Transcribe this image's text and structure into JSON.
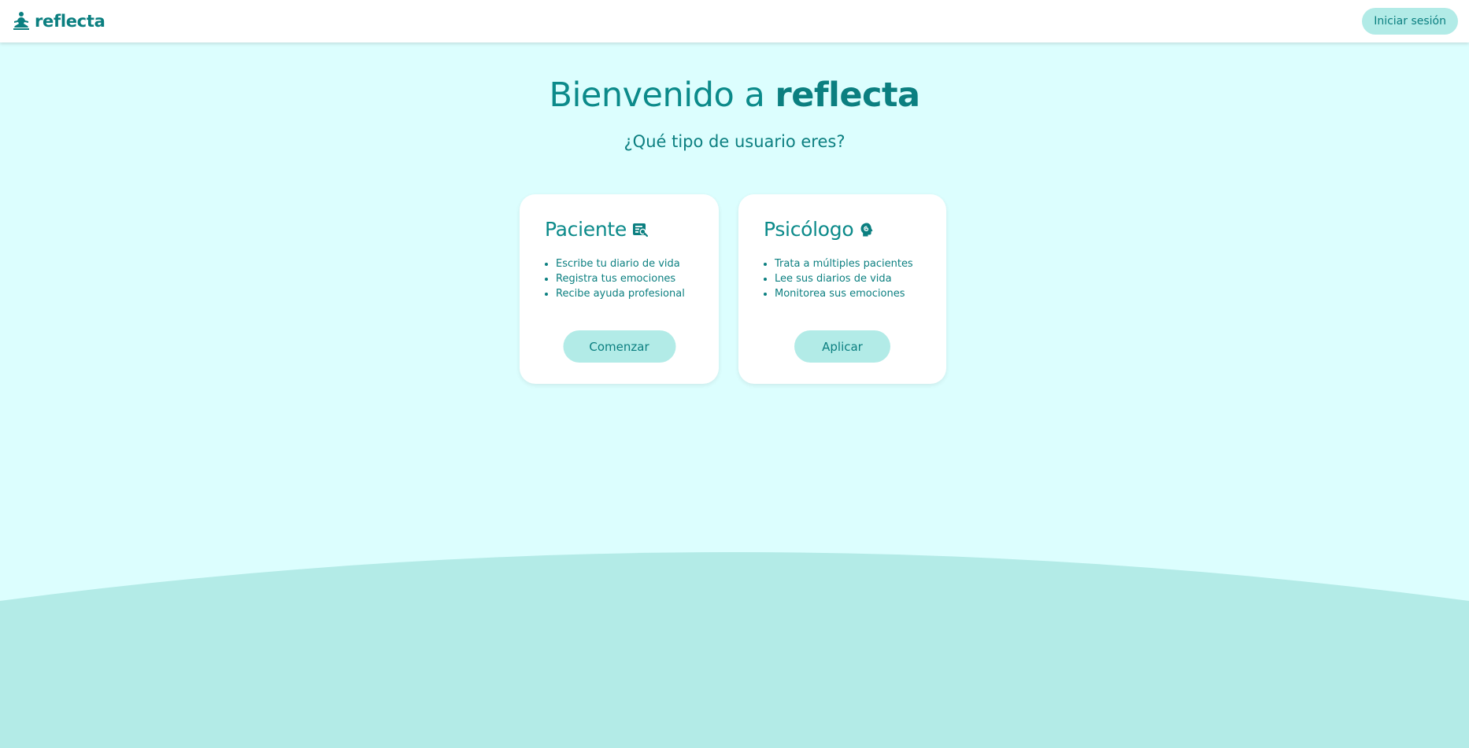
{
  "navbar": {
    "brand_name": "reflecta",
    "brand_icon": "meditation-person-icon",
    "login_label": "Iniciar sesión"
  },
  "hero": {
    "title_prefix": "Bienvenido a ",
    "title_brand": "reflecta",
    "subtitle": "¿Qué tipo de usuario eres?"
  },
  "cards": [
    {
      "title": "Paciente",
      "icon": "journal-search-icon",
      "features": [
        "Escribe tu diario de vida",
        "Registra tus emociones",
        "Recibe ayuda profesional"
      ],
      "button_label": "Comenzar"
    },
    {
      "title": "Psicólogo",
      "icon": "head-psychology-icon",
      "features": [
        "Trata a múltiples pacientes",
        "Lee sus diarios de vida",
        "Monitorea sus emociones"
      ],
      "button_label": "Aplicar"
    }
  ],
  "colors": {
    "background": "#dcfefe",
    "wave": "#b3ebe7",
    "accent": "#0b7f80",
    "button": "#b2ebe7",
    "card": "#ffffff"
  }
}
